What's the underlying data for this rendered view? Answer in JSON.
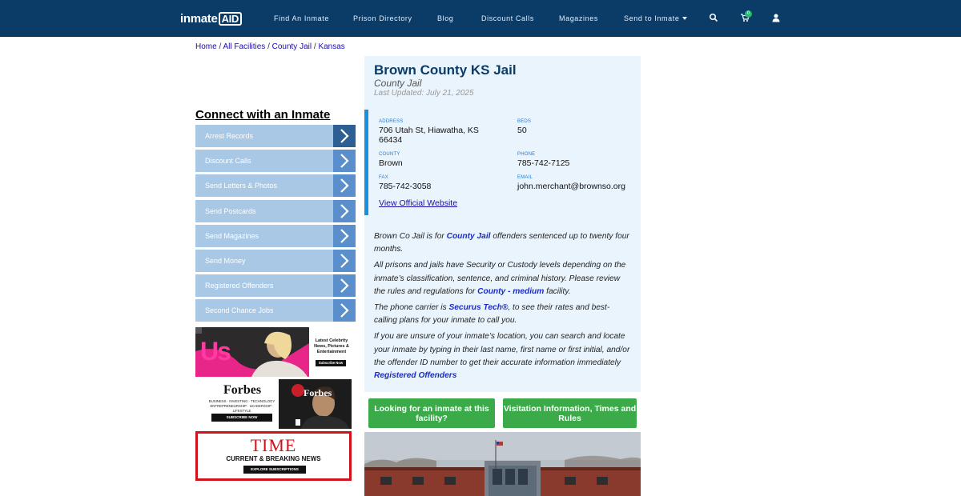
{
  "logo": {
    "text": "inmate",
    "box": "AID"
  },
  "nav": {
    "items": [
      "Find An Inmate",
      "Prison Directory",
      "Blog",
      "Discount Calls",
      "Magazines",
      "Send to Inmate"
    ],
    "cart_count": "0"
  },
  "breadcrumb": {
    "home": "Home",
    "facilities": "All Facilities",
    "type": "County Jail",
    "state": "Kansas",
    "sep": "/"
  },
  "sidebar": {
    "heading": "Connect with an Inmate",
    "items": [
      "Arrest Records",
      "Discount Calls",
      "Send Letters & Photos",
      "Send Postcards",
      "Send Magazines",
      "Send Money",
      "Registered Offenders",
      "Second Chance Jobs"
    ]
  },
  "ads": {
    "us": {
      "logo": "Us",
      "line1": "Latest Celebrity",
      "line2": "News, Pictures &",
      "line3": "Entertainment",
      "cta": "Subscribe Now"
    },
    "forbes": {
      "logo": "Forbes",
      "tag1": "BUSINESS · INVESTING · TECHNOLOGY",
      "tag2": "ENTREPRENEURSHIP · LEADERSHIP · LIFESTYLE",
      "cta": "SUBSCRIBE NOW"
    },
    "time": {
      "logo": "TIME",
      "tag": "CURRENT & BREAKING NEWS",
      "cta": "EXPLORE SUBSCRIPTIONS"
    }
  },
  "facility": {
    "name": "Brown County KS Jail",
    "type": "County Jail",
    "updated": "Last Updated: July 21, 2025",
    "address_label": "ADDRESS",
    "address_line1": "706 Utah St, Hiawatha, KS",
    "address_line2": "66434",
    "beds_label": "BEDS",
    "beds": "50",
    "county_label": "COUNTY",
    "county": "Brown",
    "phone_label": "PHONE",
    "phone": "785-742-7125",
    "fax_label": "FAX",
    "fax": "785-742-3058",
    "email_label": "EMAIL",
    "email": "john.merchant@brownso.org",
    "website": "View Official Website"
  },
  "description": {
    "p1_a": "Brown Co Jail is for ",
    "p1_link": "County Jail",
    "p1_b": " offenders sentenced up to twenty four months.",
    "p2_a": "All prisons and jails have Security or Custody levels depending on the inmate’s classification, sentence, and criminal history. Please review the rules and regulations for ",
    "p2_link": "County - medium",
    "p2_b": " facility.",
    "p3_a": "The phone carrier is ",
    "p3_link": "Securus Tech®",
    "p3_b": ", to see their rates and best-calling plans for your inmate to call you.",
    "p4_a": "If you are unsure of your inmate’s location, you can search and locate your inmate by typing in their last name, first name or first initial, and/or the offender ID number to get their accurate information immediately ",
    "p4_link": "Registered Offenders"
  },
  "buttons": {
    "looking": "Looking for an inmate at this facility?",
    "visitation": "Visitation Information, Times and Rules"
  },
  "colors": {
    "navbar": "#0b3b67",
    "accent": "#1a8fe0",
    "button_green": "#3bab4a",
    "menu_light": "#a8c8e6",
    "menu_dark": "#5b8fcb"
  }
}
